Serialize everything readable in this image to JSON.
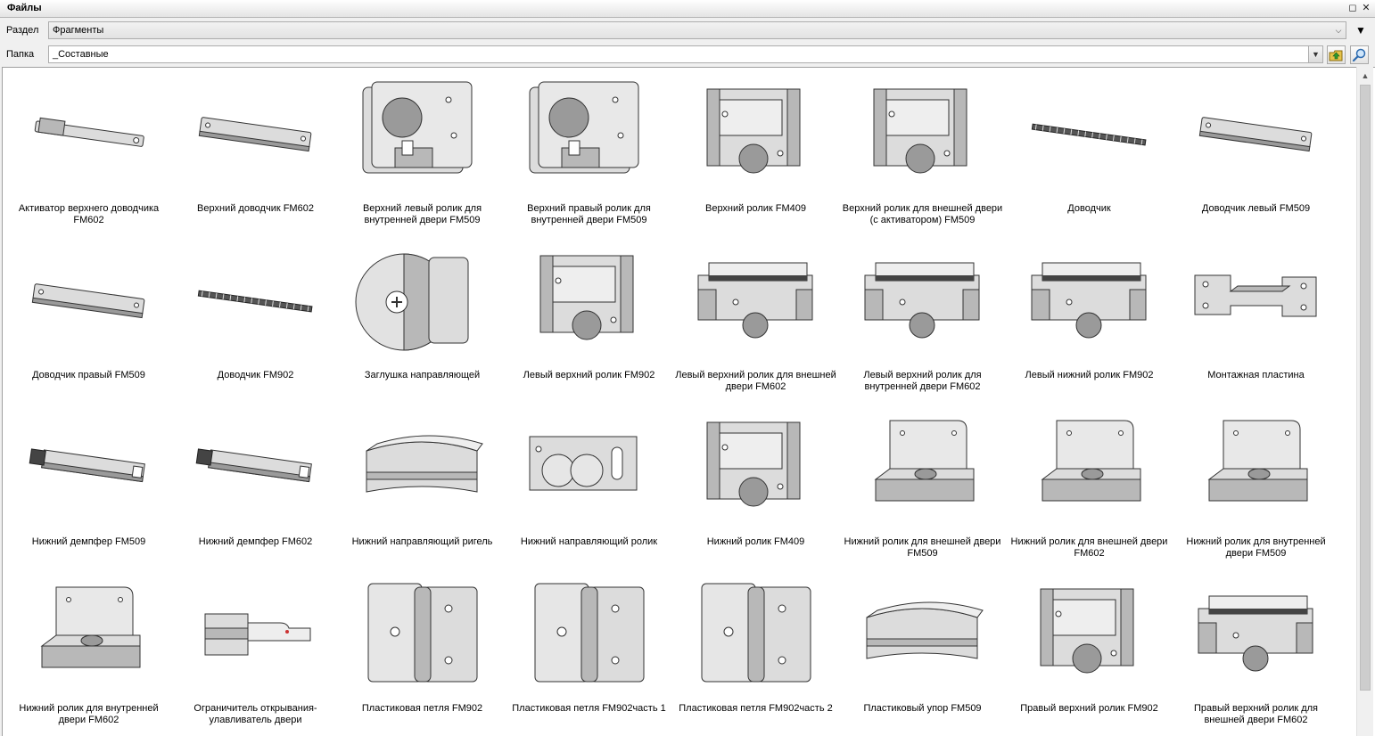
{
  "window": {
    "title": "Файлы"
  },
  "section": {
    "label": "Раздел",
    "value": "Фрагменты"
  },
  "folder": {
    "label": "Папка",
    "value": "_Составные"
  },
  "icons": {
    "restore": "restore-icon",
    "close": "close-icon",
    "dropdown": "chevron-down-icon",
    "up_folder": "folder-up-icon",
    "search": "search-icon"
  },
  "items": [
    {
      "label": "Активатор верхнего доводчика FM602",
      "shape": "bar-small"
    },
    {
      "label": "Верхний доводчик FM602",
      "shape": "bar"
    },
    {
      "label": "Верхний левый ролик для внутренней двери FM509",
      "shape": "plate-wheel"
    },
    {
      "label": "Верхний правый ролик для внутренней двери FM509",
      "shape": "plate-wheel"
    },
    {
      "label": "Верхний ролик FM409",
      "shape": "roller-box"
    },
    {
      "label": "Верхний ролик для внешней двери (с активатором) FM509",
      "shape": "roller-box"
    },
    {
      "label": "Доводчик",
      "shape": "chain"
    },
    {
      "label": "Доводчик левый FM509",
      "shape": "bar"
    },
    {
      "label": "Доводчик правый FM509",
      "shape": "bar"
    },
    {
      "label": "Доводчик FM902",
      "shape": "chain"
    },
    {
      "label": "Заглушка направляющей",
      "shape": "disc"
    },
    {
      "label": "Левый верхний ролик FM902",
      "shape": "roller-box"
    },
    {
      "label": "Левый верхний ролик для внешней двери FM602",
      "shape": "carriage"
    },
    {
      "label": "Левый верхний ролик для внутренней двери FM602",
      "shape": "carriage"
    },
    {
      "label": "Левый нижний ролик FM902",
      "shape": "carriage"
    },
    {
      "label": "Монтажная пластина",
      "shape": "bracket"
    },
    {
      "label": "Нижний демпфер FM509",
      "shape": "damper"
    },
    {
      "label": "Нижний демпфер FM602",
      "shape": "damper"
    },
    {
      "label": "Нижний направляющий ригель",
      "shape": "block"
    },
    {
      "label": "Нижний направляющий ролик",
      "shape": "two-rollers"
    },
    {
      "label": "Нижний ролик FM409",
      "shape": "roller-box"
    },
    {
      "label": "Нижний ролик для внешней двери FM509",
      "shape": "l-plate"
    },
    {
      "label": "Нижний ролик для внешней двери FM602",
      "shape": "l-plate"
    },
    {
      "label": "Нижний ролик для внутренней двери FM509",
      "shape": "l-plate"
    },
    {
      "label": "Нижний ролик для внутренней двери FM602",
      "shape": "l-plate"
    },
    {
      "label": "Ограничитель открывания-улавливатель двери",
      "shape": "limiter"
    },
    {
      "label": "Пластиковая петля FM902",
      "shape": "hinge"
    },
    {
      "label": "Пластиковая петля FM902часть 1",
      "shape": "hinge"
    },
    {
      "label": "Пластиковая петля FM902часть 2",
      "shape": "hinge"
    },
    {
      "label": "Пластиковый упор FM509",
      "shape": "block"
    },
    {
      "label": "Правый верхний ролик FM902",
      "shape": "roller-box"
    },
    {
      "label": "Правый верхний ролик для внешней двери FM602",
      "shape": "carriage"
    }
  ]
}
